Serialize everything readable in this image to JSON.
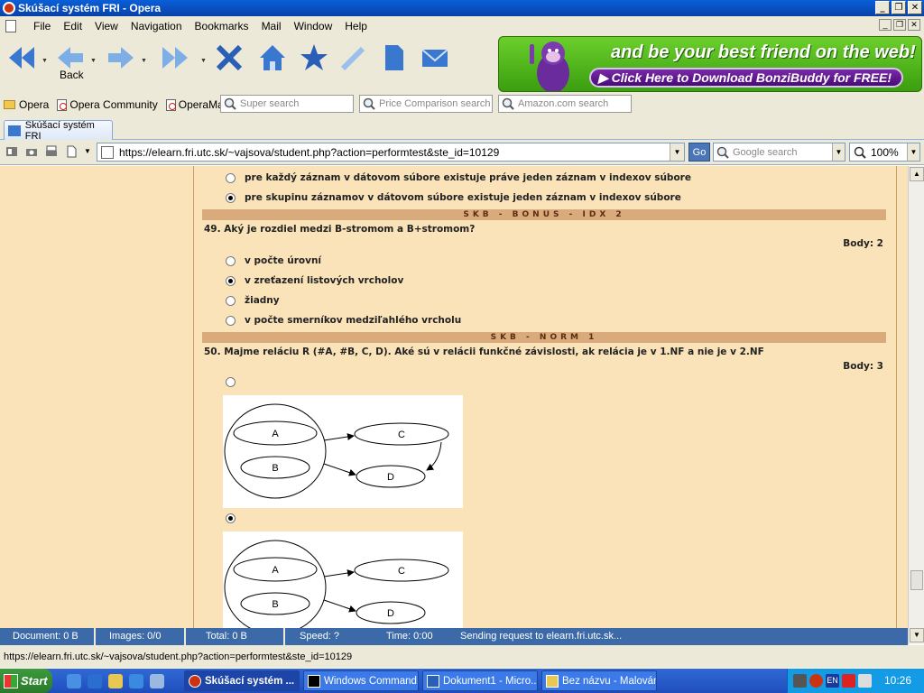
{
  "window": {
    "title": "Skúšací systém FRI - Opera"
  },
  "menu": [
    "File",
    "Edit",
    "View",
    "Navigation",
    "Bookmarks",
    "Mail",
    "Window",
    "Help"
  ],
  "toolbar": {
    "back_label": "Back"
  },
  "ad": {
    "line1": "and be your best friend on the web!",
    "line2": "▶ Click Here to Download BonziBuddy for FREE!"
  },
  "personal_bar": {
    "items": [
      "Opera",
      "Opera Community",
      "OperaMail"
    ]
  },
  "searches": [
    "Super search",
    "Price Comparison search",
    "Amazon.com search"
  ],
  "tab": {
    "label": "Skúšací systém FRI"
  },
  "address": {
    "url": "https://elearn.fri.utc.sk/~vajsova/student.php?action=performtest&ste_id=10129",
    "go": "Go",
    "search_placeholder": "Google search",
    "zoom": "100%"
  },
  "content": {
    "prev_options": [
      {
        "text": "pre každý záznam v dátovom súbore existuje práve jeden záznam v indexov súbore",
        "selected": false
      },
      {
        "text": "pre skupinu záznamov v dátovom súbore existuje jeden záznam v indexov súbore",
        "selected": true
      }
    ],
    "section1": "SKB - BONUS - IDX 2",
    "q49": {
      "text": "49. Aký je rozdiel medzi B-stromom a B+stromom?",
      "points": "Body: 2",
      "options": [
        {
          "text": "v počte úrovní",
          "selected": false
        },
        {
          "text": "v zreťazení listových vrcholov",
          "selected": true
        },
        {
          "text": "žiadny",
          "selected": false
        },
        {
          "text": "v počte smerníkov medziľahlého vrcholu",
          "selected": false
        }
      ]
    },
    "section2": "SKB - NORM 1",
    "q50": {
      "text": "50. Majme reláciu R (#A, #B, C, D). Aké sú v relácii funkčné závislosti, ak relácia je v 1.NF a nie je v 2.NF",
      "points": "Body: 3",
      "diagram_labels": {
        "a": "A",
        "b": "B",
        "c": "C",
        "d": "D"
      }
    }
  },
  "status": {
    "document": "Document:  0 B",
    "images": "Images:   0/0",
    "total": "Total:   0 B",
    "speed": "Speed:   ?",
    "time": "Time:   0:00",
    "message": "Sending request to elearn.fri.utc.sk..."
  },
  "url_status": "https://elearn.fri.utc.sk/~vajsova/student.php?action=performtest&ste_id=10129",
  "taskbar": {
    "start": "Start",
    "tasks": [
      "Skúšací systém ...",
      "Windows Command...",
      "Dokument1 - Micro...",
      "Bez názvu - Malování"
    ],
    "clock": "10:26",
    "lang": "EN"
  }
}
